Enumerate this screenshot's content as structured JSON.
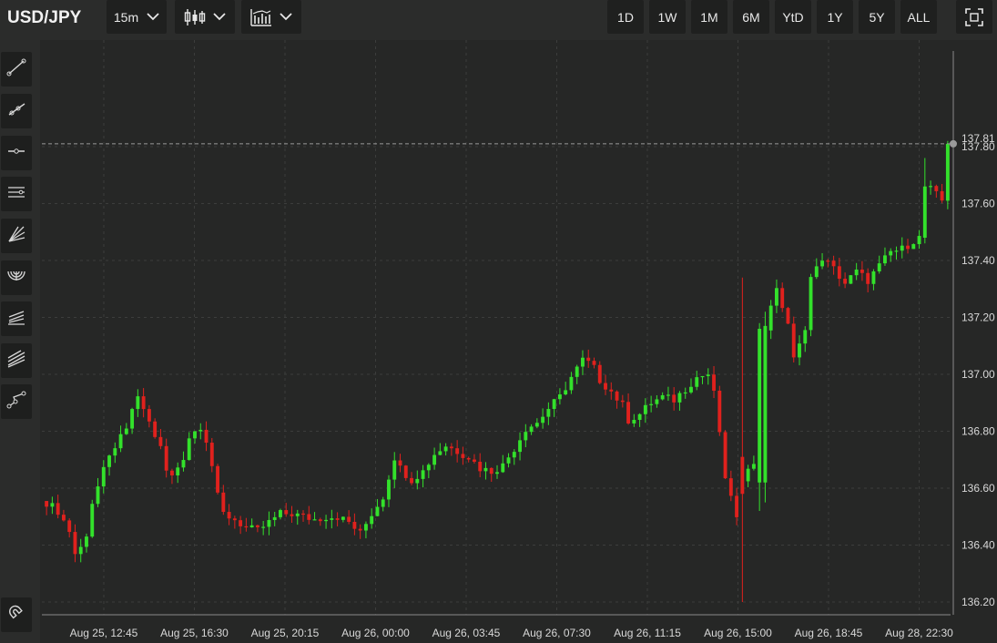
{
  "header": {
    "symbol": "USD/JPY",
    "interval": "15m",
    "chart_type_icon": "candlestick-icon",
    "indicators_icon": "indicator-icon",
    "ranges": [
      "1D",
      "1W",
      "1M",
      "6M",
      "YtD",
      "1Y",
      "5Y",
      "ALL"
    ],
    "fullscreen_icon": "fullscreen-icon"
  },
  "tools": [
    {
      "name": "trend-line-icon"
    },
    {
      "name": "ray-icon"
    },
    {
      "name": "horizontal-line-icon"
    },
    {
      "name": "parallel-channel-icon"
    },
    {
      "name": "fan-icon"
    },
    {
      "name": "arc-icon"
    },
    {
      "name": "pitchfork-icon"
    },
    {
      "name": "fibonacci-icon"
    },
    {
      "name": "path-icon"
    },
    {
      "name": "magnet-icon"
    }
  ],
  "colors": {
    "up": "#33e12b",
    "down": "#e0211d",
    "background": "#262726",
    "grid": "#3c3d3c"
  },
  "chart_data": {
    "type": "candlestick",
    "xlabel": "",
    "ylabel": "",
    "ylim": [
      136.04,
      137.99
    ],
    "yticks": [
      "136.20",
      "136.40",
      "136.60",
      "136.80",
      "137.00",
      "137.20",
      "137.40",
      "137.60",
      "137.80"
    ],
    "last_price_label": "137.81",
    "last_price": 137.81,
    "xticks": [
      "Aug 25, 12:45",
      "Aug 25, 16:30",
      "Aug 25, 20:15",
      "Aug 26, 00:00",
      "Aug 26, 03:45",
      "Aug 26, 07:30",
      "Aug 26, 11:15",
      "Aug 26, 15:00",
      "Aug 26, 18:45",
      "Aug 28, 22:30"
    ],
    "close_path": [
      [
        0,
        136.55
      ],
      [
        2,
        136.52
      ],
      [
        4,
        136.45
      ],
      [
        5,
        136.37
      ],
      [
        6,
        136.39
      ],
      [
        7,
        136.44
      ],
      [
        8,
        136.55
      ],
      [
        10,
        136.66
      ],
      [
        12,
        136.75
      ],
      [
        14,
        136.8
      ],
      [
        15,
        136.88
      ],
      [
        16,
        136.91
      ],
      [
        17,
        136.88
      ],
      [
        18,
        136.83
      ],
      [
        20,
        136.74
      ],
      [
        21,
        136.66
      ],
      [
        22,
        136.64
      ],
      [
        24,
        136.71
      ],
      [
        25,
        136.78
      ],
      [
        27,
        136.82
      ],
      [
        28,
        136.77
      ],
      [
        29,
        136.68
      ],
      [
        30,
        136.57
      ],
      [
        31,
        136.51
      ],
      [
        33,
        136.49
      ],
      [
        35,
        136.46
      ],
      [
        37,
        136.45
      ],
      [
        39,
        136.48
      ],
      [
        41,
        136.51
      ],
      [
        43,
        136.51
      ],
      [
        45,
        136.5
      ],
      [
        47,
        136.49
      ],
      [
        49,
        136.5
      ],
      [
        51,
        136.5
      ],
      [
        53,
        136.48
      ],
      [
        55,
        136.44
      ],
      [
        57,
        136.51
      ],
      [
        59,
        136.57
      ],
      [
        60,
        136.64
      ],
      [
        61,
        136.71
      ],
      [
        62,
        136.67
      ],
      [
        64,
        136.63
      ],
      [
        66,
        136.66
      ],
      [
        68,
        136.72
      ],
      [
        70,
        136.75
      ],
      [
        72,
        136.73
      ],
      [
        74,
        136.71
      ],
      [
        76,
        136.67
      ],
      [
        78,
        136.66
      ],
      [
        80,
        136.68
      ],
      [
        82,
        136.74
      ],
      [
        84,
        136.81
      ],
      [
        86,
        136.83
      ],
      [
        88,
        136.88
      ],
      [
        90,
        136.92
      ],
      [
        92,
        136.99
      ],
      [
        94,
        137.05
      ],
      [
        95,
        137.04
      ],
      [
        96,
        137.02
      ],
      [
        97,
        136.98
      ],
      [
        99,
        136.94
      ],
      [
        101,
        136.89
      ],
      [
        102,
        136.84
      ],
      [
        104,
        136.86
      ],
      [
        106,
        136.9
      ],
      [
        108,
        136.92
      ],
      [
        110,
        136.91
      ],
      [
        112,
        136.95
      ],
      [
        114,
        136.99
      ],
      [
        116,
        137.0
      ],
      [
        117,
        136.93
      ],
      [
        118,
        136.8
      ],
      [
        119,
        136.62
      ],
      [
        120,
        136.58
      ],
      [
        121,
        136.49
      ],
      [
        122,
        136.61
      ],
      [
        123,
        136.68
      ],
      [
        124,
        136.7
      ],
      [
        125,
        136.62
      ],
      [
        126,
        137.16
      ],
      [
        127,
        137.25
      ],
      [
        128,
        137.29
      ],
      [
        129,
        137.24
      ],
      [
        130,
        137.18
      ],
      [
        131,
        137.05
      ],
      [
        132,
        137.1
      ],
      [
        133,
        137.17
      ],
      [
        134,
        137.34
      ],
      [
        135,
        137.37
      ],
      [
        136,
        137.41
      ],
      [
        138,
        137.37
      ],
      [
        140,
        137.32
      ],
      [
        142,
        137.36
      ],
      [
        144,
        137.33
      ],
      [
        146,
        137.38
      ],
      [
        148,
        137.43
      ],
      [
        150,
        137.44
      ],
      [
        152,
        137.47
      ],
      [
        153,
        137.48
      ],
      [
        154,
        137.66
      ],
      [
        155,
        137.65
      ],
      [
        156,
        137.63
      ],
      [
        157,
        137.61
      ],
      [
        158,
        137.81
      ]
    ],
    "special_candles": [
      {
        "i": 122,
        "open": 136.71,
        "high": 137.34,
        "low": 136.2,
        "close": 136.58
      },
      {
        "i": 125,
        "open": 136.62,
        "high": 137.18,
        "low": 136.52,
        "close": 137.16
      },
      {
        "i": 126,
        "open": 136.62,
        "high": 137.22,
        "low": 136.55,
        "close": 137.17
      },
      {
        "i": 158,
        "open": 137.61,
        "high": 137.82,
        "low": 137.58,
        "close": 137.81
      },
      {
        "i": 154,
        "open": 137.48,
        "high": 137.76,
        "low": 137.46,
        "close": 137.66
      }
    ]
  }
}
